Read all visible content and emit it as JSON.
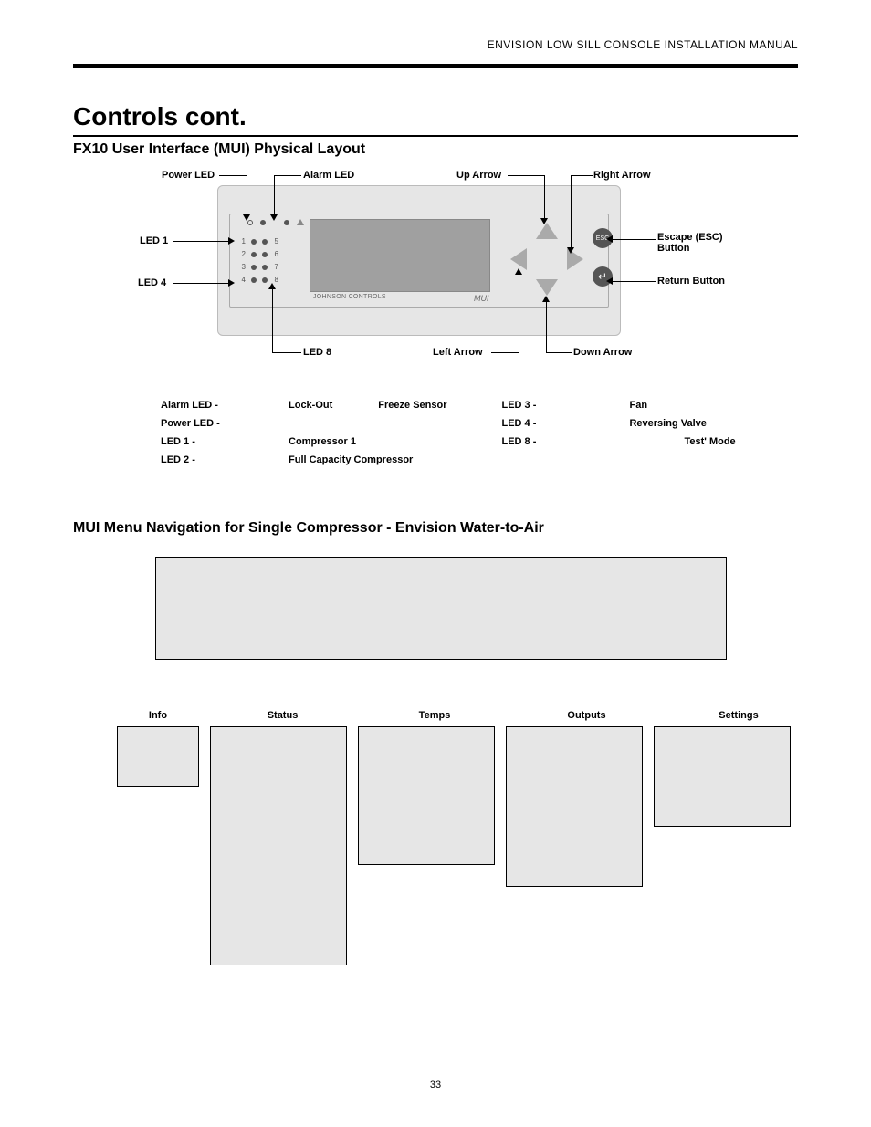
{
  "header": {
    "manual_title": "ENVISION LOW SILL CONSOLE INSTALLATION MANUAL"
  },
  "page": {
    "number": "33"
  },
  "section": {
    "title": "Controls cont.",
    "sub_a": "FX10 User Interface (MUI) Physical Layout",
    "sub_b": "MUI Menu Navigation for Single Compressor  - Envision Water-to-Air"
  },
  "device": {
    "brand": "JOHNSON CONTROLS",
    "mui": "MUI",
    "esc_text": "ESC",
    "led_numbers": [
      "1",
      "2",
      "3",
      "4",
      "5",
      "6",
      "7",
      "8"
    ]
  },
  "callouts": {
    "power_led": "Power LED",
    "alarm_led": "Alarm LED",
    "up_arrow": "Up Arrow",
    "right_arrow": "Right Arrow",
    "escape": "Escape (ESC) Button",
    "return": "Return Button",
    "led1": "LED 1",
    "led4": "LED 4",
    "led8": "LED 8",
    "left_arrow": "Left Arrow",
    "down_arrow": "Down Arrow"
  },
  "legend": {
    "left": [
      {
        "key": "Alarm LED -",
        "val1": "Lock-Out",
        "val2": "Freeze Sensor"
      },
      {
        "key": "Power LED -",
        "val1": "",
        "val2": ""
      },
      {
        "key": "LED 1 -",
        "val1": "Compressor 1",
        "val2": ""
      },
      {
        "key": "LED 2 -",
        "val1": "Full Capacity Compressor",
        "val2": ""
      }
    ],
    "right": [
      {
        "key": "LED 3 -",
        "val": "Fan"
      },
      {
        "key": "LED 4 -",
        "val": "Reversing Valve"
      },
      {
        "key": "LED 8 -",
        "val": "Test' Mode",
        "indent": true
      }
    ]
  },
  "menu": {
    "labels": [
      "Info",
      "Status",
      "Temps",
      "Outputs",
      "Settings"
    ]
  }
}
